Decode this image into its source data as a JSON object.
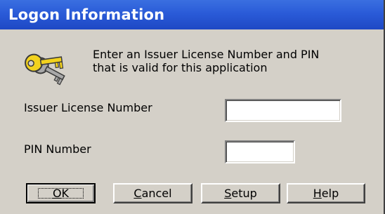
{
  "window": {
    "title": "Logon Information"
  },
  "icon": "keys-icon",
  "message": {
    "line1": "Enter an Issuer License Number and PIN",
    "line2": "that is valid for this application"
  },
  "fields": {
    "issuer_label": "Issuer License Number",
    "issuer_value": "",
    "pin_label": "PIN Number",
    "pin_value": ""
  },
  "buttons": [
    {
      "key": "O",
      "rest": "K"
    },
    {
      "key": "C",
      "rest": "ancel"
    },
    {
      "key": "S",
      "rest": "etup"
    },
    {
      "key": "H",
      "rest": "elp"
    }
  ]
}
